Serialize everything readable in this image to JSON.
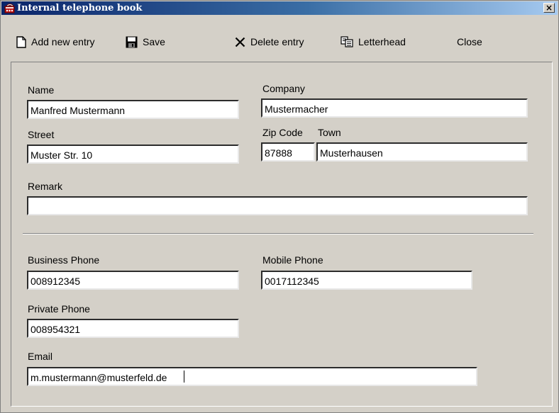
{
  "window": {
    "title": "Internal telephone book",
    "close_glyph": "×"
  },
  "toolbar": {
    "add_label": "Add new entry",
    "save_label": "Save",
    "delete_label": "Delete entry",
    "letterhead_label": "Letterhead",
    "close_label": "Close"
  },
  "form": {
    "name": {
      "label": "Name",
      "value": "Manfred Mustermann"
    },
    "company": {
      "label": "Company",
      "value": "Mustermacher"
    },
    "street": {
      "label": "Street",
      "value": "Muster Str. 10"
    },
    "zip": {
      "label": "Zip Code",
      "value": "87888"
    },
    "town": {
      "label": "Town",
      "value": "Musterhausen"
    },
    "remark": {
      "label": "Remark",
      "value": ""
    },
    "business_phone": {
      "label": "Business Phone",
      "value": "008912345"
    },
    "mobile_phone": {
      "label": "Mobile Phone",
      "value": "0017112345"
    },
    "private_phone": {
      "label": "Private Phone",
      "value": "008954321"
    },
    "email": {
      "label": "Email",
      "value": "m.mustermann@musterfeld.de"
    }
  },
  "icons": {
    "app": "phonebook-icon",
    "add": "new-document-icon",
    "save": "floppy-disk-icon",
    "delete": "x-delete-icon",
    "letterhead": "copy-documents-icon"
  },
  "colors": {
    "titlebar_start": "#0a246a",
    "titlebar_end": "#a6caf0",
    "face": "#d4d0c8"
  }
}
